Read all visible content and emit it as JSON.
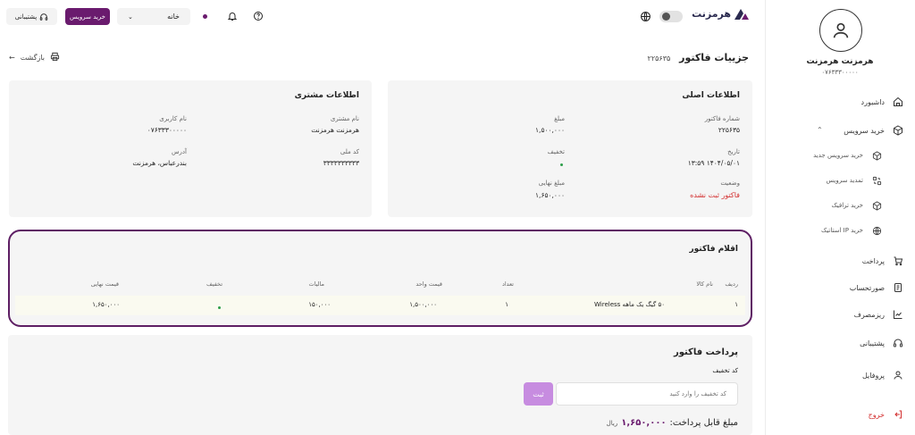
{
  "header": {
    "logo_text": "هرمزنت",
    "home_select": "خانه",
    "buy_service": "خرید سرویس",
    "support": "پشتیبانی"
  },
  "sidebar": {
    "user_name": "هرمزنت هرمزنت",
    "user_phone": "۰۷۶۳۳۳۰۰۰۰۰",
    "items": [
      {
        "label": "داشبورد",
        "icon": "home-icon"
      },
      {
        "label": "خرید سرویس",
        "icon": "box-icon"
      },
      {
        "label": "خرید سرویس جدید",
        "icon": "box-icon"
      },
      {
        "label": "تمدید سرویس",
        "icon": "renew-icon"
      },
      {
        "label": "خرید ترافیک",
        "icon": "box-icon"
      },
      {
        "label": "خرید IP استاتیک",
        "icon": "globe-icon"
      },
      {
        "label": "پرداخت",
        "icon": "cart-icon"
      },
      {
        "label": "صورتحساب",
        "icon": "invoice-icon"
      },
      {
        "label": "ریزمصرف",
        "icon": "chart-icon"
      },
      {
        "label": "پشتیبانی",
        "icon": "headset-icon"
      },
      {
        "label": "پروفایل",
        "icon": "user-icon"
      },
      {
        "label": "خروج",
        "icon": "logout-icon"
      }
    ]
  },
  "page": {
    "title": "جزییات فاکتور",
    "invoice_number": "۲۲۵۶۳۵",
    "back": "بازگشت"
  },
  "main_info": {
    "title": "اطلاعات اصلی",
    "invoice_no_label": "شماره فاکتور",
    "invoice_no": "۲۲۵۶۳۵",
    "amount_label": "مبلغ",
    "amount": "۱,۵۰۰,۰۰۰",
    "date_label": "تاریخ",
    "date": "۱۴۰۴/۰۵/۰۱ ۱۳:۵۹",
    "discount_label": "تخفیف",
    "status_label": "وضعیت",
    "status": "فاکتور ثبت نشده",
    "final_label": "مبلغ نهایی",
    "final": "۱,۶۵۰,۰۰۰"
  },
  "customer_info": {
    "title": "اطلاعات مشتری",
    "name_label": "نام مشتری",
    "name": "هرمزنت هرمزنت",
    "username_label": "نام کاربری",
    "username": "۰۷۶۳۳۳۰۰۰۰۰",
    "national_label": "کد ملی",
    "national": "۳۳۳۳۳۳۳۳۳۳",
    "address_label": "آدرس",
    "address": "بندرعباس، هرمزنت"
  },
  "items": {
    "title": "اقلام فاکتور",
    "headers": [
      "ردیف",
      "نام کالا",
      "تعداد",
      "قیمت واحد",
      "مالیات",
      "تخفیف",
      "قیمت نهایی"
    ],
    "rows": [
      [
        "۱",
        "۵۰ گیگ یک ماهه Wireless",
        "۱",
        "۱,۵۰۰,۰۰۰",
        "۱۵۰,۰۰۰",
        "",
        "۱,۶۵۰,۰۰۰"
      ]
    ]
  },
  "payment": {
    "title": "پرداخت فاکتور",
    "discount_code_label": "کد تخفیف",
    "placeholder": "کد تخفیف را وارد کنید",
    "submit": "ثبت",
    "payable_label": "مبلغ قابل پرداخت:",
    "payable_amount": "۱,۶۵۰,۰۰۰",
    "currency": "ریال"
  },
  "colors": {
    "brand": "#6a1b6e",
    "danger": "#d32f2f",
    "success": "#2e9e4a"
  }
}
